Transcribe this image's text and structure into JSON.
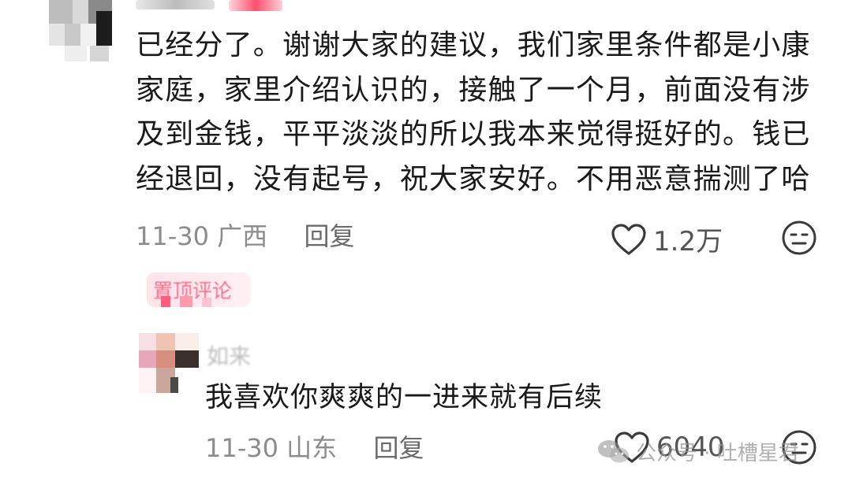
{
  "top_comment": {
    "lines": [
      "已经分了。谢谢大家的建议，我们家里条件都是小康",
      "家庭，家里介绍认识的，接触了一个月，前面没有涉",
      "及到金钱，平平淡淡的所以我本来觉得挺好的。钱已",
      "经退回，没有起号，祝大家安好。不用恶意揣测了哈"
    ],
    "date": "11-30",
    "location": "广西",
    "reply_label": "回复",
    "like_count": "1.2万",
    "pinned_label": "置顶评论"
  },
  "reply_comment": {
    "username": "如来",
    "text": "我喜欢你爽爽的一进来就有后续",
    "date": "11-30",
    "location": "山东",
    "reply_label": "回复",
    "like_count": "6040"
  },
  "watermark": {
    "text": "公众号 · 吐槽星君"
  },
  "icons": {
    "like": "heart-outline-icon",
    "reaction": "neutral-face-icon",
    "watermark": "wechat-icon"
  },
  "colors": {
    "text_primary": "#1a1a1a",
    "text_meta": "#8c8c8c",
    "pinned_tag_bg": "#ffe3ea",
    "pinned_tag_text": "#f25b7a"
  }
}
